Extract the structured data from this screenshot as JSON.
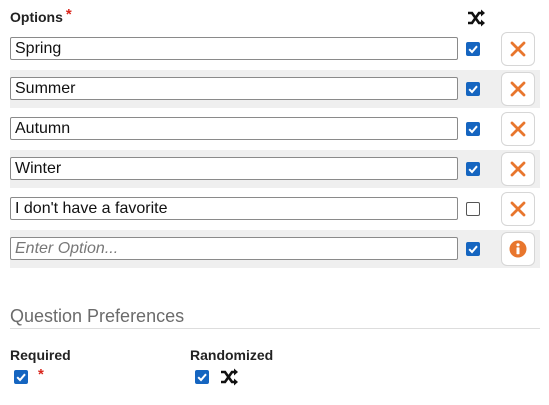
{
  "options_section": {
    "title": "Options",
    "required_marker": "*",
    "randomize_icon": "shuffle-icon",
    "rows": [
      {
        "value": "Spring",
        "placeholder": "",
        "checked": true,
        "action_icon": "close-icon"
      },
      {
        "value": "Summer",
        "placeholder": "",
        "checked": true,
        "action_icon": "close-icon"
      },
      {
        "value": "Autumn",
        "placeholder": "",
        "checked": true,
        "action_icon": "close-icon"
      },
      {
        "value": "Winter",
        "placeholder": "",
        "checked": true,
        "action_icon": "close-icon"
      },
      {
        "value": "I don't have a favorite",
        "placeholder": "",
        "checked": false,
        "action_icon": "close-icon"
      },
      {
        "value": "",
        "placeholder": "Enter Option...",
        "checked": true,
        "action_icon": "info-icon"
      }
    ]
  },
  "question_preferences": {
    "title": "Question Preferences",
    "required": {
      "label": "Required",
      "checked": true,
      "marker": "*"
    },
    "randomized": {
      "label": "Randomized",
      "checked": true,
      "icon": "shuffle-icon"
    }
  },
  "colors": {
    "accent_blue": "#1565c0",
    "action_orange": "#e8762d",
    "required_red": "#d9261c",
    "stripe_gray": "#efefef"
  }
}
